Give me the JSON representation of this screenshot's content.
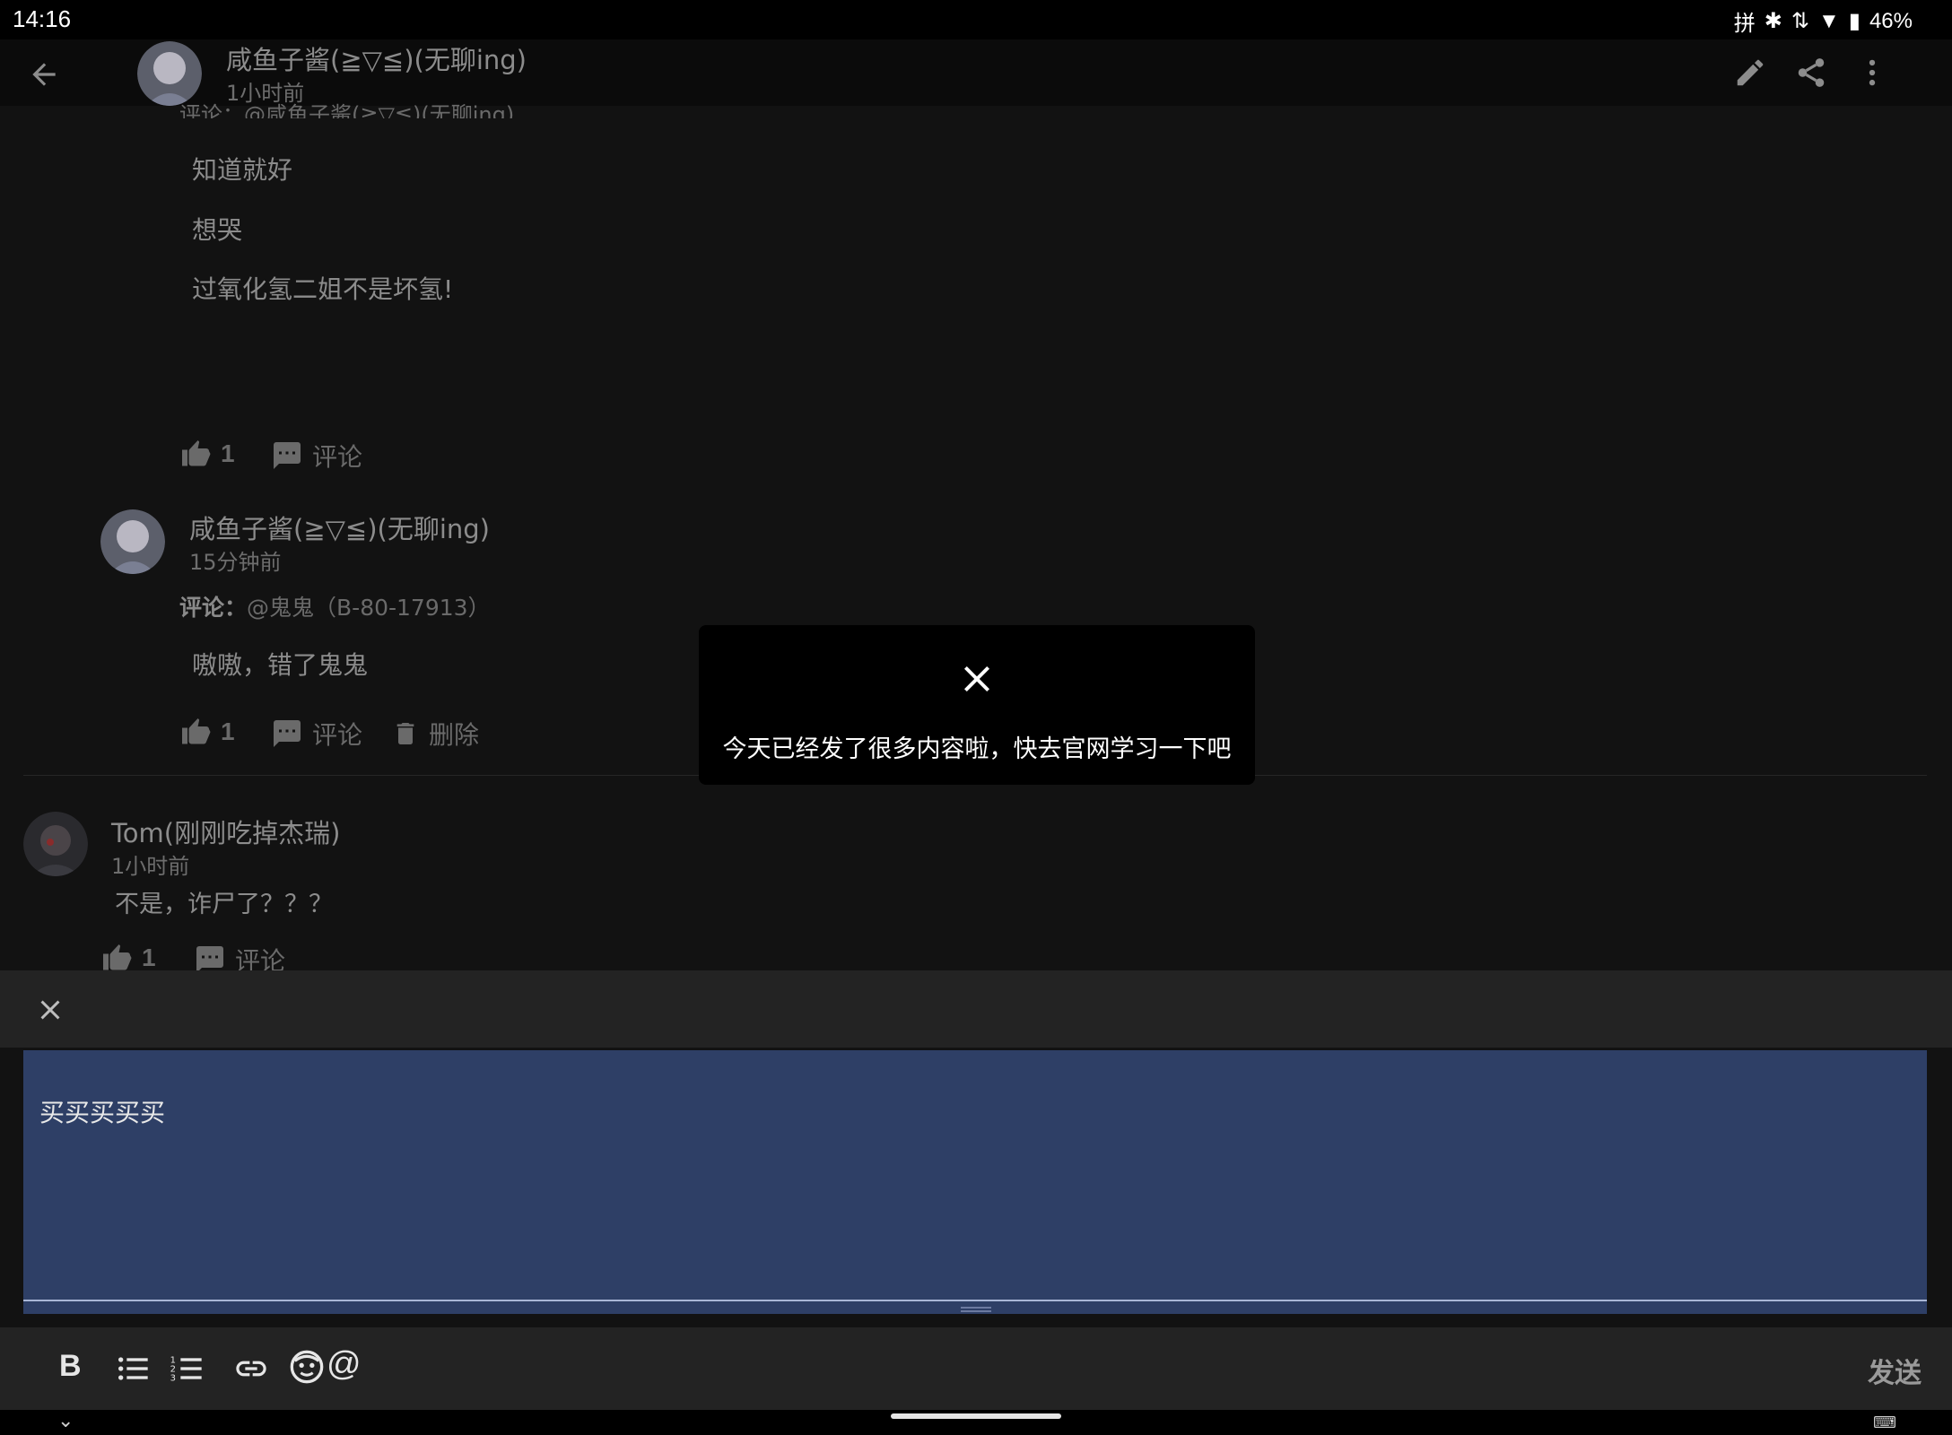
{
  "status": {
    "time": "14:16",
    "ime": "拼",
    "battery": "46%"
  },
  "header": {
    "author": "咸鱼子酱(≧▽≦)(无聊ing)",
    "time": "1小时前"
  },
  "thread1": {
    "cut_line": "评论：@咸鱼子酱(≧▽≦)(无聊ing)",
    "lines": [
      "知道就好",
      "想哭",
      "过氧化氢二姐不是坏氢!"
    ],
    "likes": "1",
    "comment_label": "评论"
  },
  "thread2": {
    "author": "咸鱼子酱(≧▽≦)(无聊ing)",
    "time": "15分钟前",
    "ref_label": "评论：",
    "ref_target": "@鬼鬼（B-80-17913）",
    "text": "嗷嗷，错了鬼鬼",
    "likes": "1",
    "comment_label": "评论",
    "delete_label": "删除"
  },
  "thread3": {
    "author": "Tom(刚刚吃掉杰瑞)",
    "time": "1小时前",
    "text": "不是，诈尸了？？？",
    "likes": "1",
    "comment_label": "评论"
  },
  "toast": {
    "message": "今天已经发了很多内容啦，快去官网学习一下吧"
  },
  "editor": {
    "text": "买买买买买",
    "send_label": "发送"
  },
  "icons": [
    "back-arrow-icon",
    "edit-icon",
    "share-icon",
    "more-icon",
    "thumb-up-icon",
    "comment-icon",
    "delete-icon",
    "close-icon",
    "bold-icon",
    "bullet-list-icon",
    "numbered-list-icon",
    "link-icon",
    "emoji-icon",
    "mention-icon",
    "keyboard-icon"
  ],
  "colors": {
    "editor_bg": "#2e3f66",
    "background": "#121212",
    "toast_bg": "#000000"
  }
}
